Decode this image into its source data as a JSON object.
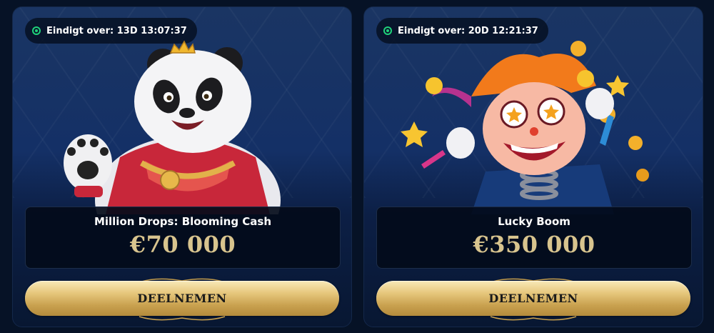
{
  "cards": [
    {
      "timer": "Eindigt over: 13D 13:07:37",
      "title": "Million Drops: Blooming Cash",
      "prize": "€70 000",
      "button": "DEELNEMEN",
      "mascot": "panda-mascot"
    },
    {
      "timer": "Eindigt over: 20D 12:21:37",
      "title": "Lucky Boom",
      "prize": "€350 000",
      "button": "DEELNEMEN",
      "mascot": "jester-mascot"
    }
  ],
  "colors": {
    "accent_gold": "#d8c48e",
    "live_green": "#1fd27a",
    "card_bg": "#143066"
  }
}
